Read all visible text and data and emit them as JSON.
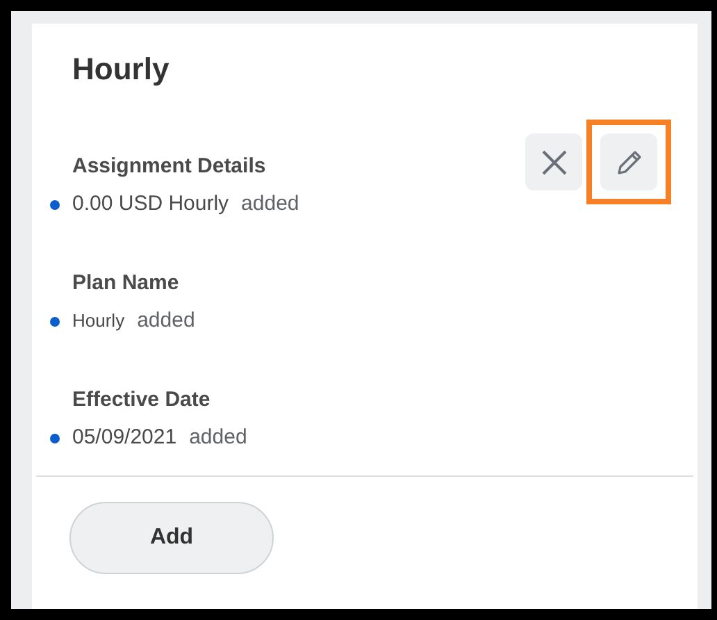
{
  "card": {
    "title": "Hourly",
    "actions": [
      {
        "kind": "remove",
        "highlighted": false
      },
      {
        "kind": "edit",
        "highlighted": true
      }
    ],
    "fields": [
      {
        "label": "Assignment Details",
        "value": "0.00 USD Hourly",
        "status": "added",
        "color": "#0b5fcc"
      },
      {
        "label": "Plan Name",
        "value": "Hourly",
        "status": "added",
        "color": "#0b5fcc"
      },
      {
        "label": "Effective Date",
        "value": "05/09/2021",
        "status": "added",
        "color": "#0b5fcc"
      }
    ],
    "add_button": "Add"
  }
}
